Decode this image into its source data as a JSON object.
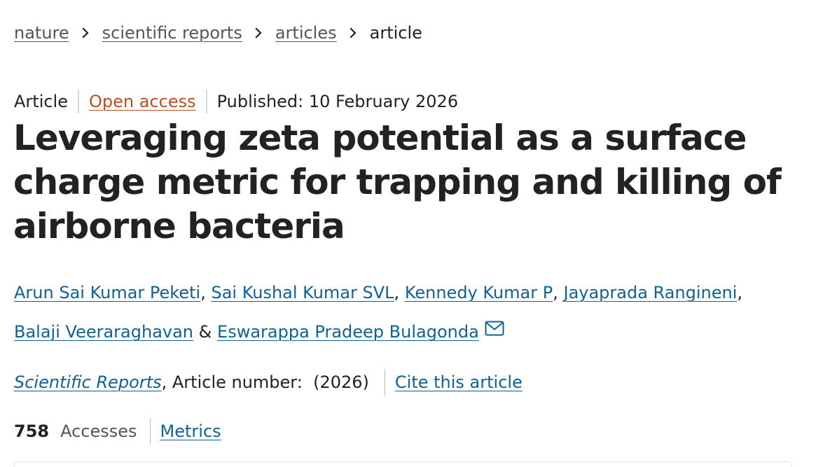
{
  "breadcrumb": {
    "items": [
      "nature",
      "scientific reports",
      "articles"
    ],
    "current": "article",
    "separator_icon": "chevron-right-icon"
  },
  "meta": {
    "type": "Article",
    "access": "Open access",
    "published": "Published: 10 February 2026"
  },
  "title": "Leveraging zeta potential as a surface charge metric for trapping and killing of airborne bacteria",
  "authors": {
    "list": [
      "Arun Sai Kumar Peketi",
      "Sai Kushal Kumar SVL",
      "Kennedy Kumar P",
      "Jayaprada Rangineni",
      "Balaji Veeraraghavan",
      "Eswarappa Pradeep Bulagonda"
    ],
    "comma": ",",
    "ampersand": "&",
    "contact_icon": "mail-icon"
  },
  "journal": {
    "name": "Scientific Reports",
    "article_number_text": ", Article number:  (2026)",
    "cite_label": "Cite this article"
  },
  "metrics": {
    "count": "758",
    "label": "Accesses",
    "link": "Metrics"
  },
  "colors": {
    "link": "#0f6294",
    "open_access": "#b8501e",
    "text": "#222222",
    "muted": "#555555"
  }
}
